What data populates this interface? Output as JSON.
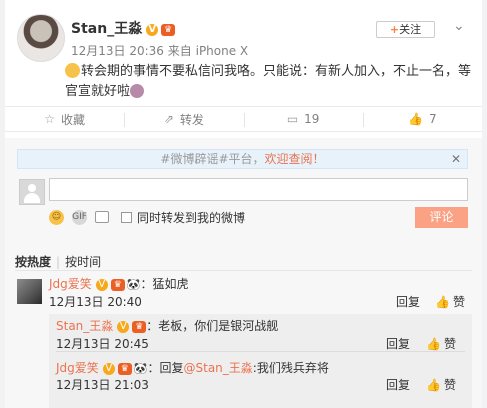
{
  "post": {
    "username": "Stan_王淼",
    "timestamp": "12月13日 20:36",
    "source_prefix": "来自",
    "source": "iPhone X",
    "follow_label": "关注",
    "content": "转会期的事情不要私信问我咯。只能说：有新人加入，不止一名，等官宣就好啦"
  },
  "actions": {
    "favorite_label": "收藏",
    "repost_label": "转发",
    "comment_count": "19",
    "like_count": "7"
  },
  "comment_box": {
    "notice_tag": "#微博辟谣#平台，",
    "notice_link": "欢迎查阅！",
    "input_value": "",
    "repost_checkbox_label": "同时转发到我的微博",
    "submit_label": "评论"
  },
  "sort": {
    "hot_label": "按热度",
    "time_label": "按时间"
  },
  "comments": [
    {
      "name": "Jdg爱笑",
      "text": "：猛如虎",
      "time": "12月13日 20:40",
      "reply_label": "回复",
      "like_label": "赞",
      "replies": [
        {
          "name": "Stan_王淼",
          "text": "：老板，你们是银河战舰",
          "time": "12月13日 20:45",
          "reply_label": "回复",
          "like_label": "赞"
        },
        {
          "name": "Jdg爱笑",
          "prefix": "：回复",
          "mention": "@Stan_王淼",
          "text": ":我们残兵弃将",
          "time": "12月13日 21:03",
          "reply_label": "回复",
          "like_label": "赞"
        }
      ]
    }
  ],
  "icons": {
    "verified": "verified-icon",
    "vip": "vip-icon",
    "accent_color": "#eb7350",
    "link_color": "#eb7350"
  }
}
